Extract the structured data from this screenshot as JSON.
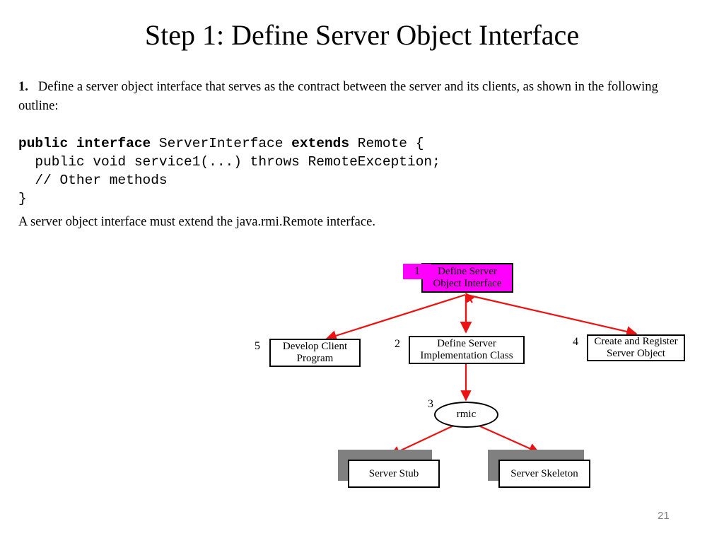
{
  "slide": {
    "title": "Step 1: Define Server Object Interface",
    "page_number": "21"
  },
  "intro": {
    "number": "1.",
    "text": "Define a server object interface that serves as the contract between the server and its clients, as shown in the following outline:"
  },
  "code": {
    "line1_bold1": "public interface",
    "line1_plain1": " ServerInterface ",
    "line1_bold2": "extends",
    "line1_plain2": " Remote {",
    "line2": "  public void service1(...) throws RemoteException;",
    "line3": "  // Other methods",
    "line4": "}"
  },
  "closing": {
    "text": "A server object interface must extend the java.rmi.Remote interface."
  },
  "diagram": {
    "nodes": [
      {
        "id": "define-server-object-interface",
        "step": "1",
        "label": "Define Server\nObject Interface",
        "highlight": true
      },
      {
        "id": "develop-client-program",
        "step": "5",
        "label": "Develop Client\nProgram",
        "highlight": false
      },
      {
        "id": "define-server-implementation-class",
        "step": "2",
        "label": "Define Server\nImplementation Class",
        "highlight": false
      },
      {
        "id": "create-and-register-server-object",
        "step": "4",
        "label": "Create and Register\nServer Object",
        "highlight": false
      },
      {
        "id": "rmic",
        "step": "3",
        "label": "rmic",
        "highlight": false
      },
      {
        "id": "server-stub",
        "step": "",
        "label": "Server Stub",
        "highlight": false
      },
      {
        "id": "server-skeleton",
        "step": "",
        "label": "Server Skeleton",
        "highlight": false
      }
    ],
    "node_labels": {
      "define_server_object_interface_line1": "Define Server",
      "define_server_object_interface_line2": "Object Interface",
      "develop_client_program_line1": "Develop Client",
      "develop_client_program_line2": "Program",
      "define_server_implementation_class_line1": "Define Server",
      "define_server_implementation_class_line2": "Implementation Class",
      "create_and_register_server_object_line1": "Create and Register",
      "create_and_register_server_object_line2": "Server Object",
      "rmic": "rmic",
      "server_stub": "Server Stub",
      "server_skeleton": "Server Skeleton"
    },
    "step_numbers": {
      "one": "1",
      "two": "2",
      "three": "3",
      "four": "4",
      "five": "5"
    },
    "colors": {
      "highlight": "#ff00ff",
      "arrow": "#ee1111",
      "shadow": "#808080",
      "outline": "#000000",
      "page_number": "#808080"
    }
  }
}
